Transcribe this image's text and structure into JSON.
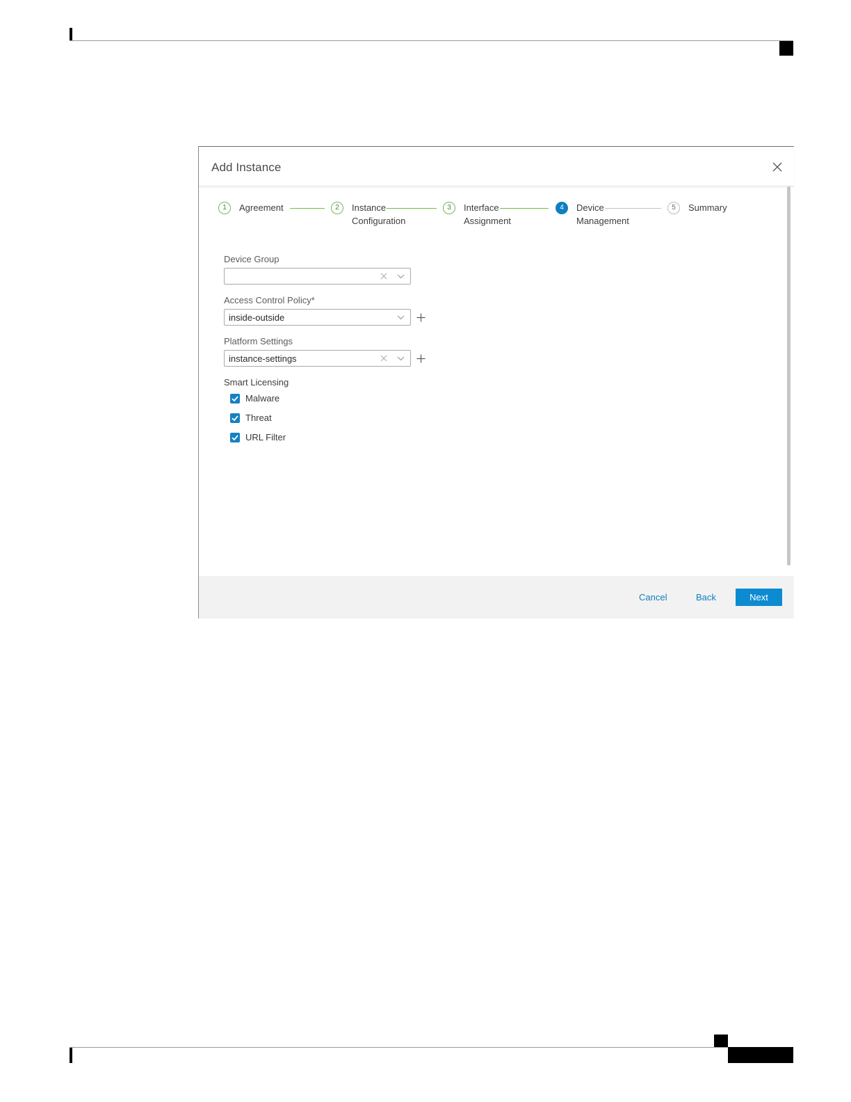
{
  "dialog": {
    "title": "Add Instance"
  },
  "stepper": {
    "steps": [
      {
        "number": "1",
        "label_line1": "Agreement",
        "label_line2": "",
        "state": "done"
      },
      {
        "number": "2",
        "label_line1": "Instance",
        "label_line2": "Configuration",
        "state": "done"
      },
      {
        "number": "3",
        "label_line1": "Interface",
        "label_line2": "Assignment",
        "state": "done"
      },
      {
        "number": "4",
        "label_line1": "Device",
        "label_line2": "Management",
        "state": "active"
      },
      {
        "number": "5",
        "label_line1": "Summary",
        "label_line2": "",
        "state": "pending"
      }
    ]
  },
  "form": {
    "device_group": {
      "label": "Device Group",
      "value": ""
    },
    "access_control_policy": {
      "label": "Access Control Policy*",
      "value": "inside-outside"
    },
    "platform_settings": {
      "label": "Platform Settings",
      "value": "instance-settings"
    },
    "smart_licensing": {
      "label": "Smart Licensing",
      "options": [
        {
          "label": "Malware",
          "checked": true
        },
        {
          "label": "Threat",
          "checked": true
        },
        {
          "label": "URL Filter",
          "checked": true
        }
      ]
    }
  },
  "footer": {
    "cancel_label": "Cancel",
    "back_label": "Back",
    "next_label": "Next"
  },
  "colors": {
    "accent": "#0e7fc0",
    "button": "#0d8bd0",
    "step_done": "#6cbf4a",
    "step_pending": "#bdbdbd",
    "footer_bg": "#f2f2f2"
  },
  "icons": {
    "close": "close-icon",
    "clear": "clear-icon",
    "chevron": "chevron-down-icon",
    "add": "plus-icon",
    "check": "checkmark-icon"
  }
}
